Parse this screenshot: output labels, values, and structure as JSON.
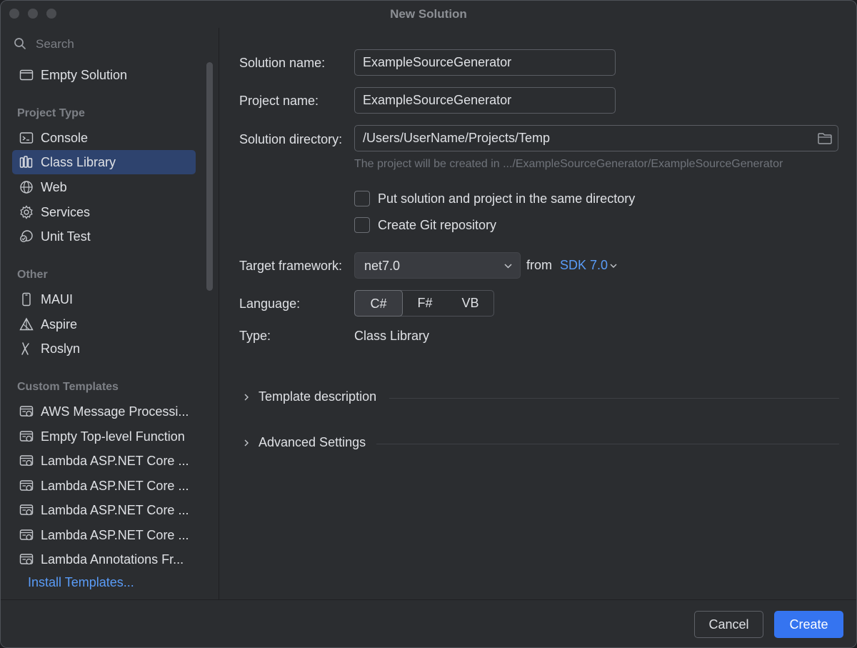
{
  "window": {
    "title": "New Solution"
  },
  "sidebar": {
    "search_placeholder": "Search",
    "empty_solution": "Empty Solution",
    "project_type_header": "Project Type",
    "project_types": [
      {
        "label": "Console",
        "icon": "console-icon",
        "selected": false
      },
      {
        "label": "Class Library",
        "icon": "class-library-icon",
        "selected": true
      },
      {
        "label": "Web",
        "icon": "globe-icon",
        "selected": false
      },
      {
        "label": "Services",
        "icon": "gear-icon",
        "selected": false
      },
      {
        "label": "Unit Test",
        "icon": "unit-test-icon",
        "selected": false
      }
    ],
    "other_header": "Other",
    "other": [
      {
        "label": "MAUI",
        "icon": "phone-icon"
      },
      {
        "label": "Aspire",
        "icon": "aspire-icon"
      },
      {
        "label": "Roslyn",
        "icon": "roslyn-icon"
      }
    ],
    "custom_header": "Custom Templates",
    "custom_templates": [
      "AWS Message Processi...",
      "Empty Top-level Function",
      "Lambda ASP.NET Core ...",
      "Lambda ASP.NET Core ...",
      "Lambda ASP.NET Core ...",
      "Lambda ASP.NET Core ...",
      "Lambda Annotations Fr..."
    ],
    "install_templates": "Install Templates..."
  },
  "form": {
    "solution_name_label": "Solution name:",
    "solution_name_value": "ExampleSourceGenerator",
    "project_name_label": "Project name:",
    "project_name_value": "ExampleSourceGenerator",
    "solution_dir_label": "Solution directory:",
    "solution_dir_value": "/Users/UserName/Projects/Temp",
    "location_hint": "The project will be created in .../ExampleSourceGenerator/ExampleSourceGenerator",
    "same_dir_label": "Put solution and project in the same directory",
    "same_dir_checked": false,
    "git_label": "Create Git repository",
    "git_checked": false,
    "framework_label": "Target framework:",
    "framework_value": "net7.0",
    "from_label": "from",
    "sdk_value": "SDK 7.0",
    "language_label": "Language:",
    "languages": [
      "C#",
      "F#",
      "VB"
    ],
    "selected_language": "C#",
    "type_label": "Type:",
    "type_value": "Class Library",
    "template_description": "Template description",
    "advanced_settings": "Advanced Settings"
  },
  "footer": {
    "cancel": "Cancel",
    "create": "Create"
  },
  "colors": {
    "accent": "#3574f0",
    "link": "#5a9cf8",
    "selection": "#2e436e",
    "background": "#2b2d30"
  }
}
